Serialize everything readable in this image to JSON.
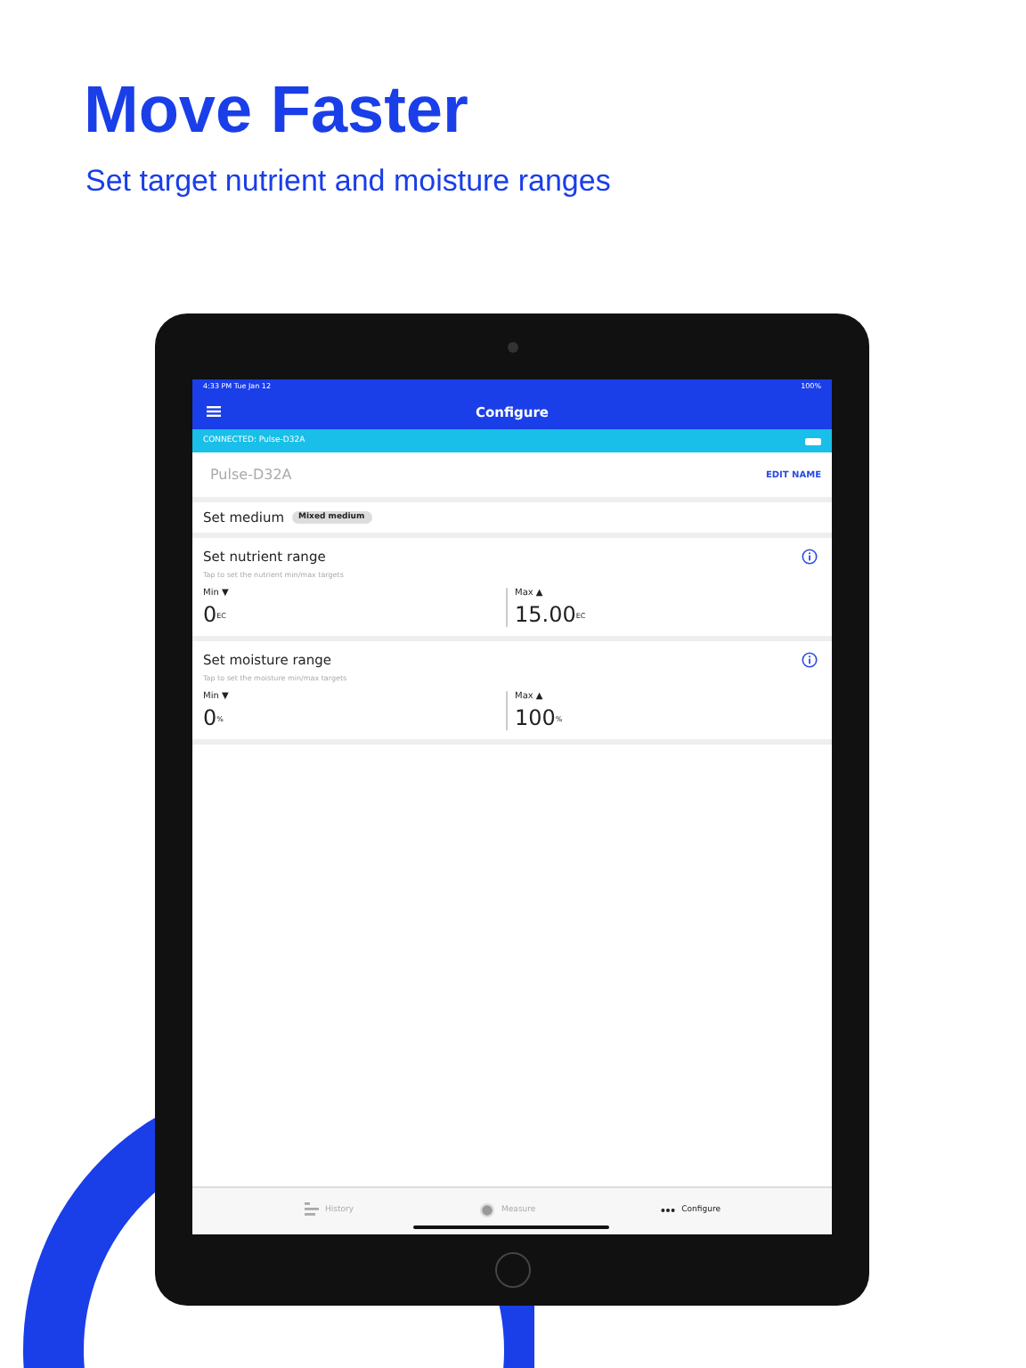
{
  "headline": "Move Faster",
  "subtitle": "Set target nutrient and moisture ranges",
  "status_bar": {
    "time": "4:33 PM  Tue Jan 12",
    "battery": "100%"
  },
  "nav": {
    "title": "Configure"
  },
  "connection": {
    "text": "CONNECTED: Pulse-D32A"
  },
  "device": {
    "name": "Pulse-D32A",
    "action": "EDIT NAME"
  },
  "medium": {
    "label": "Set medium",
    "value": "Mixed medium"
  },
  "ranges": [
    {
      "title": "Set nutrient range",
      "hint": "Tap to set the nutrient min/max targets",
      "min_label": "Min ▼",
      "min_value": "0",
      "max_label": "Max ▲",
      "min_unit": "EC",
      "max_value": "15.00",
      "max_unit": "EC"
    },
    {
      "title": "Set moisture range",
      "hint": "Tap to set the moisture min/max targets",
      "min_label": "Min ▼",
      "min_value": "0",
      "max_label": "Max ▲",
      "min_unit": "%",
      "max_value": "100",
      "max_unit": "%"
    }
  ],
  "tabs": [
    {
      "label": "History",
      "kind": "history",
      "selected": false
    },
    {
      "label": "Measure",
      "kind": "measure",
      "selected": false
    },
    {
      "label": "Configure",
      "kind": "configure",
      "selected": true
    }
  ]
}
